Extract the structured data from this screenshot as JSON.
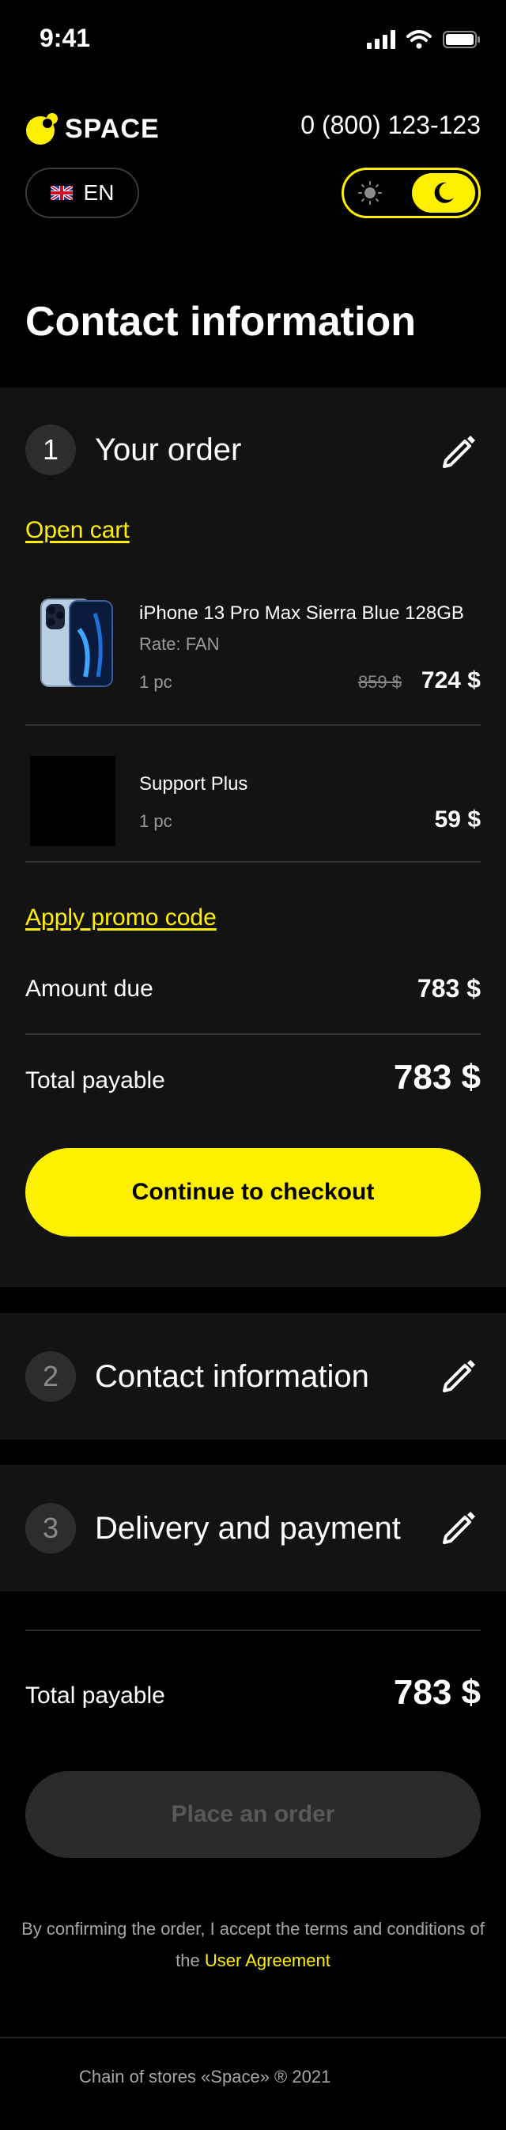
{
  "status": {
    "time": "9:41"
  },
  "header": {
    "brand": "SPACE",
    "phone": "0 (800) 123-123",
    "language": "EN"
  },
  "page": {
    "title": "Contact information"
  },
  "order": {
    "step_number": "1",
    "step_title": "Your order",
    "open_cart": "Open cart",
    "items": [
      {
        "name": "iPhone 13 Pro Max Sierra Blue 128GB",
        "rate": "Rate: FAN",
        "qty": "1 pc",
        "old_price": "859 $",
        "price": "724 $"
      },
      {
        "name": "Support Plus",
        "qty": "1 pc",
        "price": "59 $"
      }
    ],
    "promo_link": "Apply promo code",
    "amount_due_label": "Amount due",
    "amount_due_value": "783 $",
    "total_label": "Total payable",
    "total_value": "783 $",
    "checkout_button": "Continue to checkout"
  },
  "steps": [
    {
      "number": "2",
      "title": "Contact information"
    },
    {
      "number": "3",
      "title": "Delivery and payment"
    }
  ],
  "summary": {
    "total_label": "Total payable",
    "total_value": "783 $",
    "place_order_button": "Place an order",
    "terms_text": "By confirming the order, I accept the terms and conditions of the",
    "terms_link": "User Agreement"
  },
  "footer": {
    "text": "Chain of stores «Space» ® 2021"
  },
  "colors": {
    "accent": "#FFF000",
    "background": "#000000",
    "card": "#131313"
  }
}
